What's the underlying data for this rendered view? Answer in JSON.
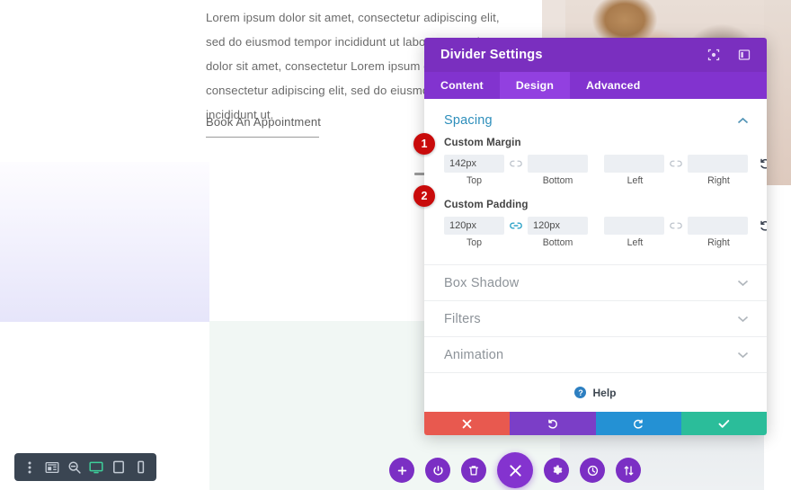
{
  "canvas": {
    "body_text": "Lorem ipsum dolor sit amet, consectetur adipiscing elit, sed do eiusmod tempor incididunt ut labore.Lorem ipsum dolor sit amet, consectetur Lorem ipsum dolor sit amet, consectetur adipiscing elit, sed do eiusmod tempor incididunt ut.",
    "cta_label": "Book An Appointment"
  },
  "modal": {
    "title": "Divider Settings",
    "header_icons": [
      {
        "name": "focus-target-icon"
      },
      {
        "name": "panel-layout-icon"
      }
    ],
    "tabs": [
      {
        "label": "Content",
        "active": false
      },
      {
        "label": "Design",
        "active": true
      },
      {
        "label": "Advanced",
        "active": false
      }
    ],
    "spacing": {
      "section_title": "Spacing",
      "collapse_chevron": "⌃",
      "margin": {
        "badge": "1",
        "label": "Custom Margin",
        "top_value": "142px",
        "bottom_value": "",
        "left_value": "",
        "right_value": "",
        "top_sublabel": "Top",
        "bottom_sublabel": "Bottom",
        "left_sublabel": "Left",
        "right_sublabel": "Right",
        "link_tb_state": "unlinked",
        "link_lr_state": "unlinked",
        "reset_icon": "reset-icon",
        "responsive_icon": "mobile-icon"
      },
      "padding": {
        "badge": "2",
        "label": "Custom Padding",
        "top_value": "120px",
        "bottom_value": "120px",
        "left_value": "",
        "right_value": "",
        "top_sublabel": "Top",
        "bottom_sublabel": "Bottom",
        "left_sublabel": "Left",
        "right_sublabel": "Right",
        "link_tb_state": "linked",
        "link_lr_state": "unlinked",
        "reset_icon": "reset-icon",
        "responsive_icon": "mobile-icon"
      }
    },
    "accordions": [
      {
        "label": "Box Shadow"
      },
      {
        "label": "Filters"
      },
      {
        "label": "Animation"
      }
    ],
    "help": {
      "label": "Help",
      "icon_char": "?"
    },
    "footer_buttons": [
      {
        "name": "discard-button",
        "icon": "✖",
        "color": "#e8594f"
      },
      {
        "name": "undo-button",
        "icon": "↺",
        "color": "#7b3ec7"
      },
      {
        "name": "redo-button",
        "icon": "↻",
        "color": "#2491d4"
      },
      {
        "name": "save-button",
        "icon": "✔",
        "color": "#2bbd9a"
      }
    ]
  },
  "device_toolbar": {
    "items": [
      {
        "name": "more-options-icon",
        "label": "More"
      },
      {
        "name": "wireframe-view-icon",
        "label": "Wireframe"
      },
      {
        "name": "zoom-out-icon",
        "label": "Zoom"
      },
      {
        "name": "desktop-view-icon",
        "label": "Desktop",
        "active": true
      },
      {
        "name": "tablet-view-icon",
        "label": "Tablet"
      },
      {
        "name": "phone-view-icon",
        "label": "Phone"
      }
    ]
  },
  "action_buttons": [
    {
      "name": "add-button",
      "label": "Add"
    },
    {
      "name": "power-button",
      "label": "Power"
    },
    {
      "name": "delete-button",
      "label": "Delete"
    },
    {
      "name": "close-button",
      "label": "Close",
      "primary": true
    },
    {
      "name": "settings-button",
      "label": "Settings"
    },
    {
      "name": "history-button",
      "label": "History"
    },
    {
      "name": "portability-button",
      "label": "Portability"
    }
  ],
  "colors": {
    "modal_header": "#7a2fbf",
    "modal_tabbar": "#8233cf",
    "tab_active": "#9240e0",
    "section_title": "#2d8ebb",
    "badge": "#c90b0b",
    "link_active": "#2ea3c8",
    "toolbar_bg": "#3a4552",
    "toolbar_active": "#3ecf9a",
    "circle_button": "#7b2fc4"
  }
}
